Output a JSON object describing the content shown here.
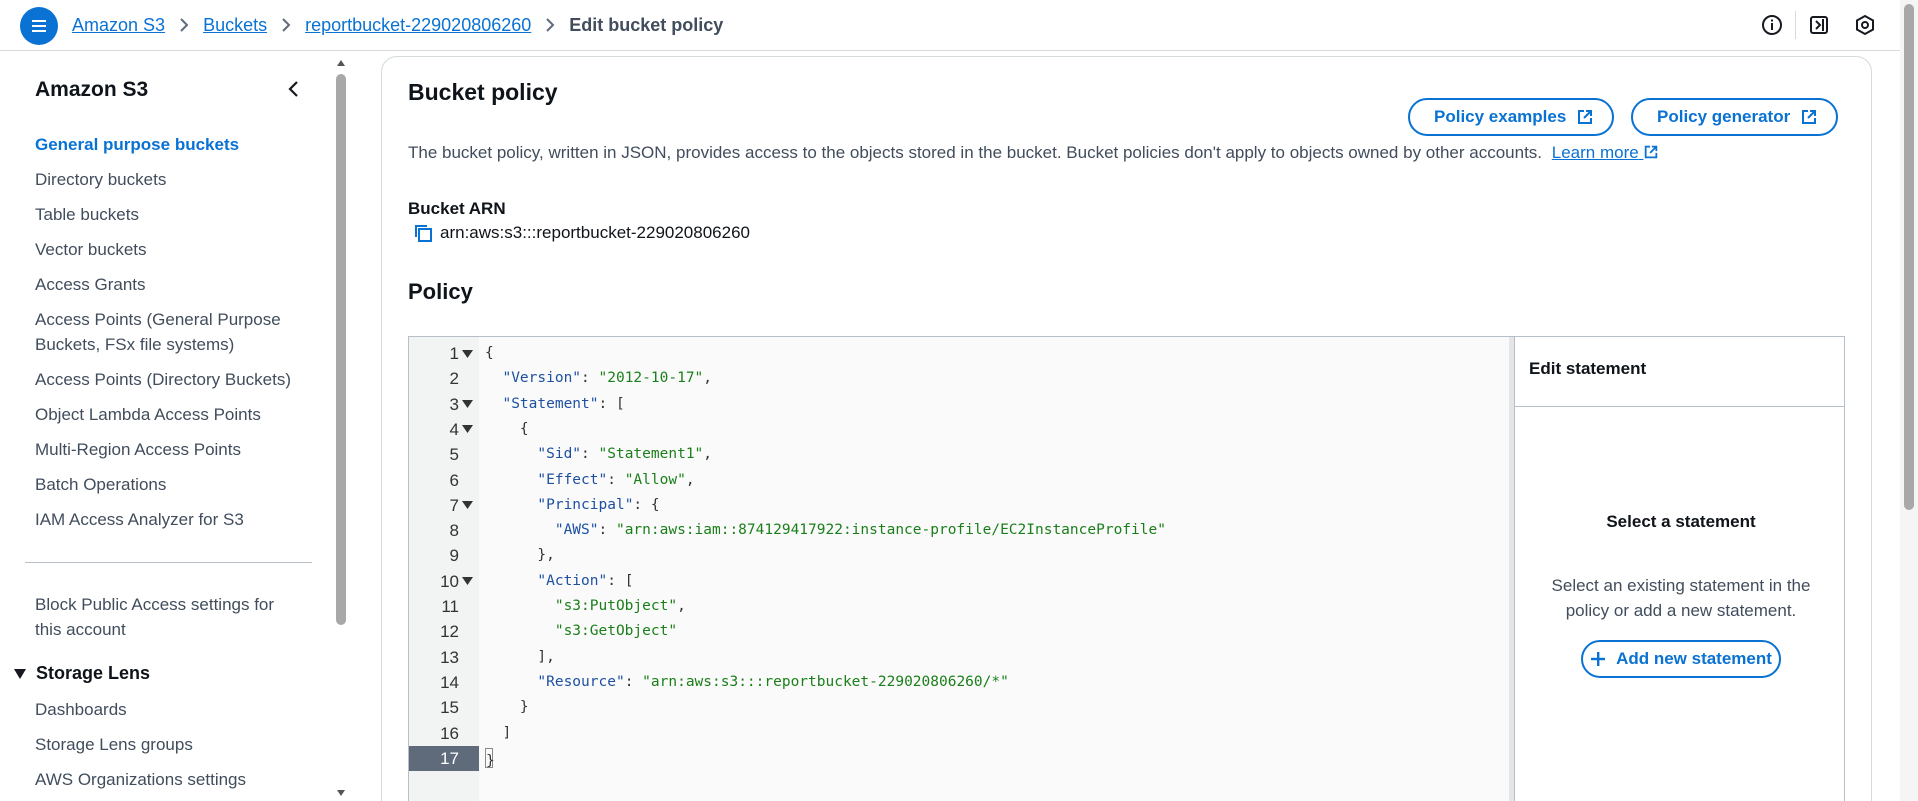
{
  "breadcrumbs": [
    {
      "label": "Amazon S3"
    },
    {
      "label": "Buckets"
    },
    {
      "label": "reportbucket-229020806260"
    },
    {
      "label": "Edit bucket policy"
    }
  ],
  "top_icons": [
    "info-icon",
    "notifications-icon",
    "settings-icon"
  ],
  "sidebar": {
    "title": "Amazon S3",
    "items": [
      {
        "label": "General purpose buckets",
        "active": true
      },
      {
        "label": "Directory buckets"
      },
      {
        "label": "Table buckets"
      },
      {
        "label": "Vector buckets"
      },
      {
        "label": "Access Grants"
      },
      {
        "label": "Access Points (General Purpose Buckets, FSx file systems)"
      },
      {
        "label": "Access Points (Directory Buckets)"
      },
      {
        "label": "Object Lambda Access Points"
      },
      {
        "label": "Multi-Region Access Points"
      },
      {
        "label": "Batch Operations"
      },
      {
        "label": "IAM Access Analyzer for S3"
      }
    ],
    "items2": [
      {
        "label": "Block Public Access settings for this account"
      }
    ],
    "storage_lens": {
      "title": "Storage Lens",
      "items": [
        {
          "label": "Dashboards"
        },
        {
          "label": "Storage Lens groups"
        },
        {
          "label": "AWS Organizations settings"
        }
      ]
    }
  },
  "main": {
    "title": "Bucket policy",
    "policy_examples_label": "Policy examples",
    "policy_generator_label": "Policy generator",
    "description": "The bucket policy, written in JSON, provides access to the objects stored in the bucket. Bucket policies don't apply to objects owned by other accounts.",
    "learn_more": "Learn more",
    "arn_label": "Bucket ARN",
    "arn_value": "arn:aws:s3:::reportbucket-229020806260",
    "policy_heading": "Policy"
  },
  "editor": {
    "lines": [
      {
        "n": "1",
        "fold": true,
        "text": "{"
      },
      {
        "n": "2",
        "fold": false,
        "text": "  \"Version\": \"2012-10-17\","
      },
      {
        "n": "3",
        "fold": true,
        "text": "  \"Statement\": ["
      },
      {
        "n": "4",
        "fold": true,
        "text": "    {"
      },
      {
        "n": "5",
        "fold": false,
        "text": "      \"Sid\": \"Statement1\","
      },
      {
        "n": "6",
        "fold": false,
        "text": "      \"Effect\": \"Allow\","
      },
      {
        "n": "7",
        "fold": true,
        "text": "      \"Principal\": {"
      },
      {
        "n": "8",
        "fold": false,
        "text": "        \"AWS\": \"arn:aws:iam::874129417922:instance-profile/EC2InstanceProfile\""
      },
      {
        "n": "9",
        "fold": false,
        "text": "      },"
      },
      {
        "n": "10",
        "fold": true,
        "text": "      \"Action\": ["
      },
      {
        "n": "11",
        "fold": false,
        "text": "        \"s3:PutObject\","
      },
      {
        "n": "12",
        "fold": false,
        "text": "        \"s3:GetObject\""
      },
      {
        "n": "13",
        "fold": false,
        "text": "      ],"
      },
      {
        "n": "14",
        "fold": false,
        "text": "      \"Resource\": \"arn:aws:s3:::reportbucket-229020806260/*\""
      },
      {
        "n": "15",
        "fold": false,
        "text": "    }"
      },
      {
        "n": "16",
        "fold": false,
        "text": "  ]"
      },
      {
        "n": "17",
        "fold": false,
        "text": "}",
        "active": true
      }
    ]
  },
  "statement_panel": {
    "title": "Edit statement",
    "empty_title": "Select a statement",
    "empty_desc": "Select an existing statement in the policy or add a new statement.",
    "add_label": "Add new statement"
  },
  "colors": {
    "accent": "#0972d3",
    "key": "#1e50a2",
    "string": "#1a7f1a"
  }
}
